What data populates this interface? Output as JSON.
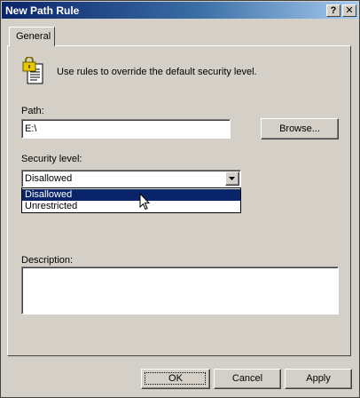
{
  "window": {
    "title": "New Path Rule"
  },
  "titlebar": {
    "help_glyph": "?",
    "close_glyph": "✕"
  },
  "tabs": [
    {
      "label": "General"
    }
  ],
  "info": {
    "icon": "lock-document-icon",
    "text": "Use rules to override the default security level."
  },
  "path": {
    "label": "Path:",
    "value": "E:\\",
    "browse_label": "Browse..."
  },
  "security": {
    "label": "Security level:",
    "selected": "Disallowed",
    "options": [
      {
        "label": "Disallowed",
        "highlighted": true
      },
      {
        "label": "Unrestricted",
        "highlighted": false
      }
    ]
  },
  "description": {
    "label": "Description:",
    "value": ""
  },
  "buttons": {
    "ok": "OK",
    "cancel": "Cancel",
    "apply": "Apply"
  },
  "colors": {
    "titlebar_start": "#0a246a",
    "titlebar_end": "#a6caf0",
    "face": "#d4d0c8",
    "highlight": "#0a246a"
  }
}
